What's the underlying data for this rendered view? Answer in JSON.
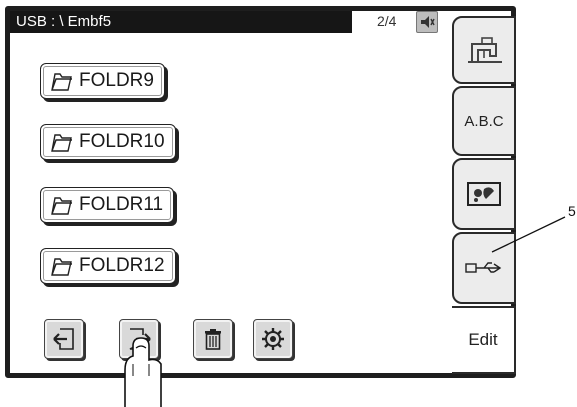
{
  "titlebar": {
    "path": "USB : \\ Embf5"
  },
  "page_indicator": "2/4",
  "folders": [
    {
      "label": "FOLDR9"
    },
    {
      "label": "FOLDR10"
    },
    {
      "label": "FOLDR11"
    },
    {
      "label": "FOLDR12"
    }
  ],
  "side_tabs": {
    "abc_label": "A.B.C",
    "edit_label": "Edit"
  },
  "callout": "5",
  "icons": {
    "speaker": "speaker-icon",
    "sewing": "sewing-machine-icon",
    "embroidery": "embroidery-design-icon",
    "usb": "usb-icon",
    "prev": "page-back-icon",
    "next": "page-forward-icon",
    "delete": "trash-icon",
    "settings": "gear-icon",
    "folder": "folder-icon"
  },
  "colors": {
    "titlebar_bg": "#161616",
    "frame": "#1e1e1e",
    "button_bg": "#d9d9d9"
  }
}
